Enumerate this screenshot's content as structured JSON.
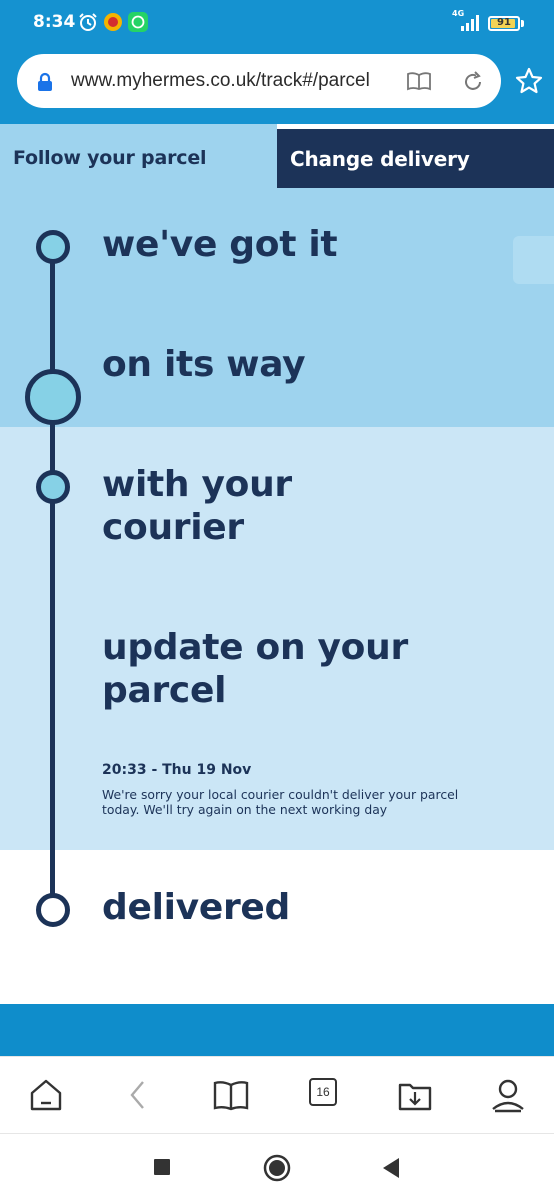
{
  "status_bar": {
    "time": "8:34",
    "network": "4G",
    "battery": "91",
    "battery_level": 0.91
  },
  "browser": {
    "url": "www.myhermes.co.uk/track#/parcel",
    "icons": [
      "lock-icon",
      "reader-mode-icon",
      "reload-icon",
      "bookmark-star-icon"
    ]
  },
  "page": {
    "tabs": {
      "follow": "Follow your parcel",
      "change": "Change delivery"
    },
    "stages": {
      "got_it": "we've got it",
      "on_way": "on its way",
      "courier_1": "with your",
      "courier_2": "courier",
      "update_1": "update on your",
      "update_2": "parcel",
      "delivered": "delivered"
    },
    "update": {
      "time": "20:33 - Thu 19 Nov",
      "message": "We're sorry your local courier couldn't deliver your parcel today. We'll try again on the next working day"
    },
    "colors": {
      "navy": "#1c3358",
      "sky": "#9ed3ee",
      "pale": "#cbe6f6",
      "brand_blue": "#0f8dcb"
    }
  },
  "toolbar": {
    "tab_count": "16",
    "icons": [
      "home-icon",
      "back-icon",
      "bookmarks-icon",
      "tabs-icon",
      "downloads-icon",
      "profile-icon"
    ]
  },
  "system_nav": {
    "icons": [
      "recents-icon",
      "home-icon",
      "back-icon"
    ]
  }
}
